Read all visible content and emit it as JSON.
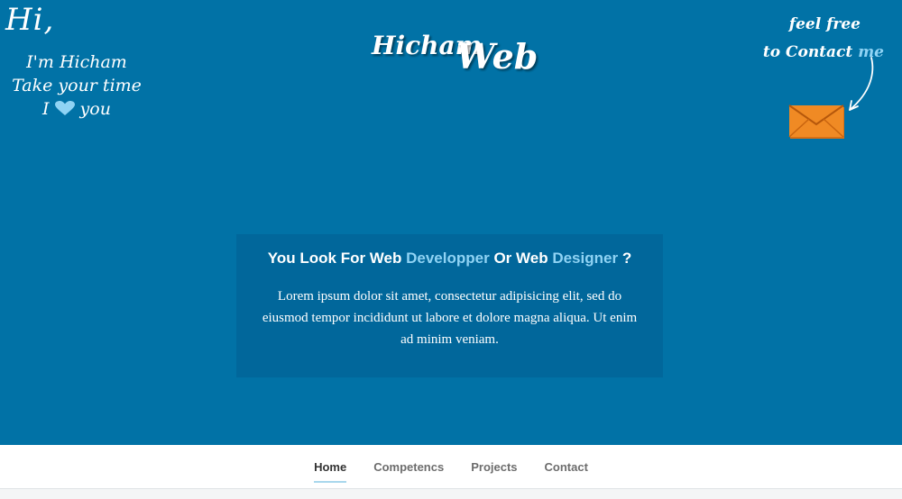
{
  "colors": {
    "hero_background": "#0172a6",
    "card_background": "#01679b",
    "highlight": "#8fd3f4",
    "envelope": "#f08a24",
    "nav_active_underline": "#a8d7ec"
  },
  "greeting": {
    "hi": "Hi,",
    "line1": "I'm Hicham",
    "line2": "Take your time",
    "line3_start": "I",
    "line3_icon": "heart-icon",
    "line3_end": "you"
  },
  "logo": {
    "part1": "Hicham",
    "part2": "Web"
  },
  "contact_note": {
    "line1": "feel free",
    "line2_start": "to Contact",
    "line2_accent": "me",
    "arrow_icon": "curved-arrow-icon",
    "envelope_icon": "envelope-icon"
  },
  "card": {
    "title_part1": "You Look For Web",
    "title_part2": "Developper",
    "title_part3": "Or Web",
    "title_part4": "Designer",
    "title_part5": "?",
    "body": "Lorem ipsum dolor sit amet, consectetur adipisicing elit, sed do eiusmod tempor incididunt ut labore et dolore magna aliqua. Ut enim ad minim veniam."
  },
  "nav": {
    "items": [
      {
        "label": "Home",
        "active": true
      },
      {
        "label": "Competencs",
        "active": false
      },
      {
        "label": "Projects",
        "active": false
      },
      {
        "label": "Contact",
        "active": false
      }
    ]
  }
}
